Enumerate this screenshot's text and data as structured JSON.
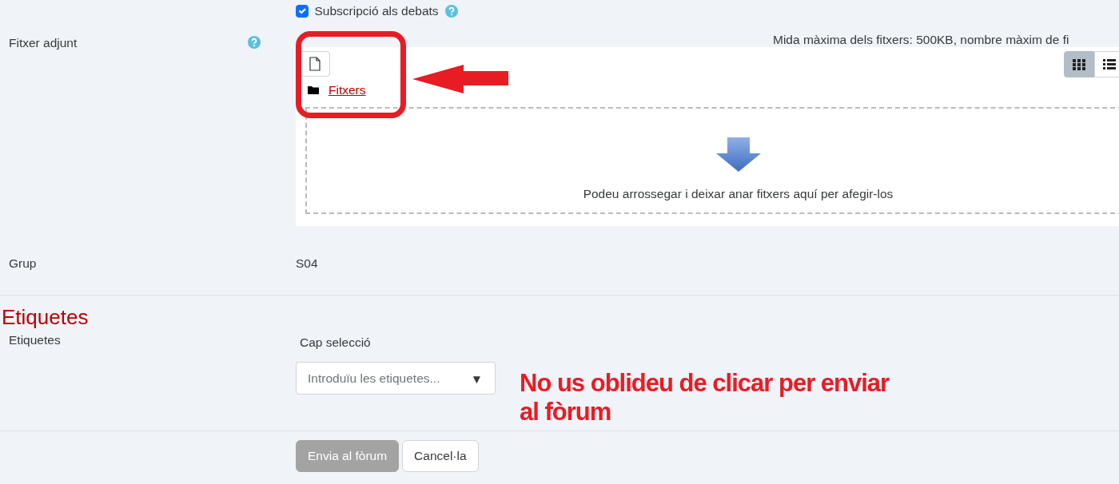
{
  "subscription": {
    "label": "Subscripció als debats",
    "checked": true
  },
  "attachment": {
    "label": "Fitxer adjunt",
    "limits": "Mida màxima dels fitxers: 500KB, nombre màxim de fi",
    "folder": "Fitxers",
    "drop_hint": "Podeu arrossegar i deixar anar fitxers aquí per afegir-los",
    "view_modes": [
      {
        "kind": "grid",
        "selected": true
      },
      {
        "kind": "list",
        "selected": false
      }
    ]
  },
  "group": {
    "label": "Grup",
    "value": "S04"
  },
  "tags_section": {
    "heading": "Etiquetes",
    "label": "Etiquetes",
    "selection": "Cap selecció",
    "placeholder": "Introduïu les etiquetes...",
    "dropdown_arrow": "▼"
  },
  "buttons": [
    {
      "label": "Envia al fòrum",
      "kind": "primary"
    },
    {
      "label": "Cancel·la",
      "kind": "secondary"
    }
  ],
  "annotation": {
    "text": "No us oblideu de clicar per enviar al fòrum"
  }
}
